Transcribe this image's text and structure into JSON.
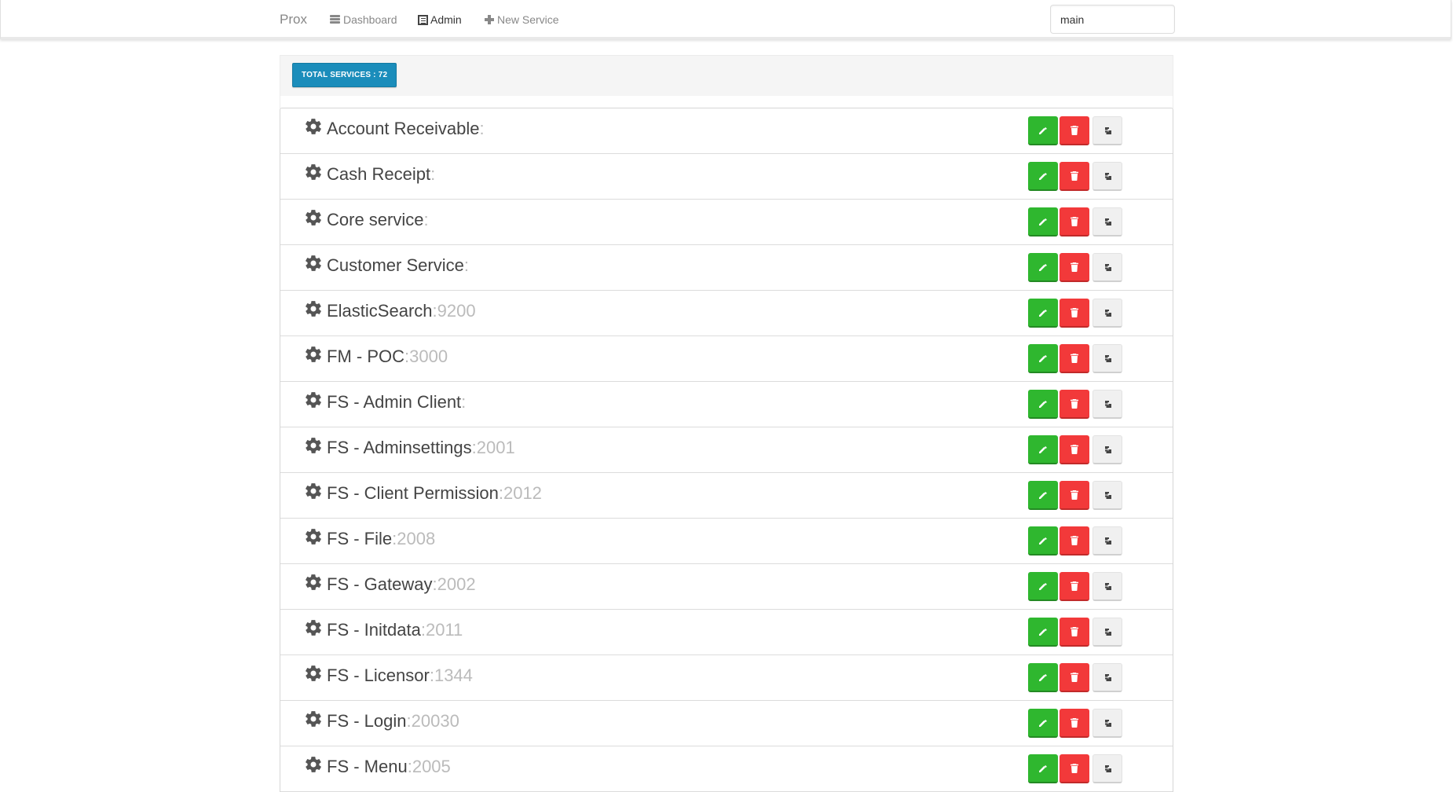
{
  "nav": {
    "brand": "Prox",
    "items": [
      {
        "label": "Dashboard",
        "icon": "dashboard-icon",
        "active": false
      },
      {
        "label": "Admin",
        "icon": "admin-icon",
        "active": true
      },
      {
        "label": "New Service",
        "icon": "plus-icon",
        "active": false
      }
    ],
    "environment_value": "main"
  },
  "summary": {
    "total_label": "TOTAL SERVICES : 72"
  },
  "colors": {
    "edit": "#2fb72f",
    "delete": "#f2393a",
    "badge": "#1b8dbb"
  },
  "services": [
    {
      "name": "Account Receivable",
      "port": ""
    },
    {
      "name": "Cash Receipt",
      "port": ""
    },
    {
      "name": "Core service",
      "port": ""
    },
    {
      "name": "Customer Service",
      "port": ""
    },
    {
      "name": "ElasticSearch",
      "port": "9200"
    },
    {
      "name": "FM - POC",
      "port": "3000"
    },
    {
      "name": "FS - Admin Client",
      "port": ""
    },
    {
      "name": "FS - Adminsettings",
      "port": "2001"
    },
    {
      "name": "FS - Client Permission",
      "port": "2012"
    },
    {
      "name": "FS - File",
      "port": "2008"
    },
    {
      "name": "FS - Gateway",
      "port": "2002"
    },
    {
      "name": "FS - Initdata",
      "port": "2011"
    },
    {
      "name": "FS - Licensor",
      "port": "1344"
    },
    {
      "name": "FS - Login",
      "port": "20030"
    },
    {
      "name": "FS - Menu",
      "port": "2005"
    }
  ]
}
